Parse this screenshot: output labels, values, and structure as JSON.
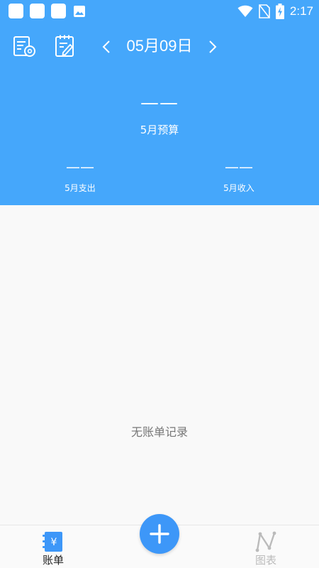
{
  "status_bar": {
    "time": "2:17",
    "notification_icons": [
      "app-notification-icon",
      "app-notification-icon",
      "app-notification-icon",
      "image-icon"
    ],
    "indicator_icons": [
      "wifi-icon",
      "no-sim-icon",
      "battery-charging-icon"
    ]
  },
  "toolbar": {
    "left_icons": [
      "bill-settings-icon",
      "notepad-edit-icon"
    ],
    "date": "05月09日",
    "prev_icon": "chevron-left-icon",
    "next_icon": "chevron-right-icon"
  },
  "summary": {
    "budget_value": "——",
    "budget_label": "5月预算",
    "expense_value": "——",
    "expense_label": "5月支出",
    "income_value": "——",
    "income_label": "5月收入"
  },
  "list": {
    "empty_text": "无账单记录"
  },
  "bottom_nav": {
    "tabs": [
      {
        "label": "账单",
        "icon": "bill-book-icon",
        "active": true
      },
      {
        "label": "图表",
        "icon": "line-chart-icon",
        "active": false
      }
    ],
    "add_icon": "plus-icon"
  },
  "colors": {
    "header_blue": "#45a7fb",
    "fab_blue": "#3d97f8",
    "active_tab": "#3d97f8",
    "inactive_tab": "#bbbbbb",
    "body_bg": "#f9f9f9",
    "empty_text": "#777777"
  }
}
